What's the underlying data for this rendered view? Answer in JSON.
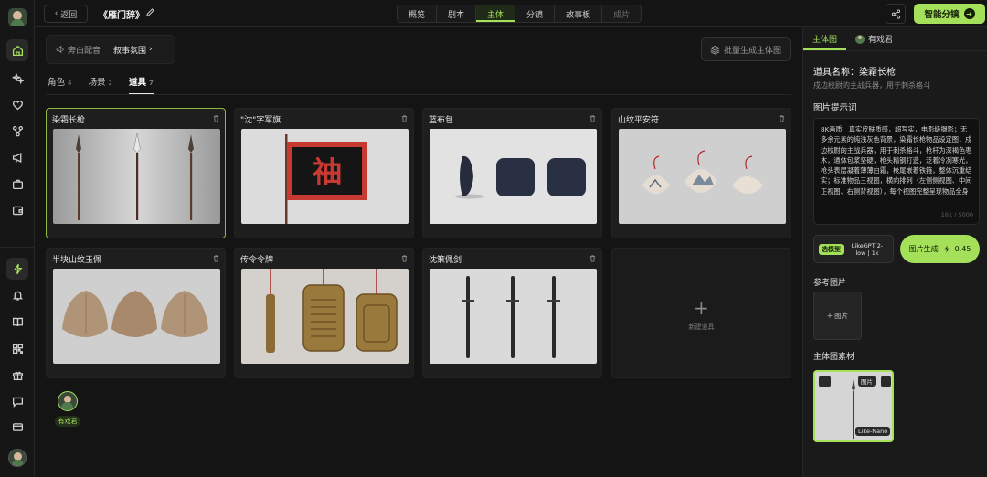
{
  "topbar": {
    "back_label": "返回",
    "doc_title": "《雁门辞》",
    "tabs": [
      {
        "label": "概览",
        "state": "normal"
      },
      {
        "label": "剧本",
        "state": "normal"
      },
      {
        "label": "主体",
        "state": "active"
      },
      {
        "label": "分镜",
        "state": "normal"
      },
      {
        "label": "故事板",
        "state": "normal"
      },
      {
        "label": "成片",
        "state": "disabled"
      }
    ],
    "smart_button": "智能分镜"
  },
  "voice_bar": {
    "narration": "旁白配音",
    "ambience": "叙事氛围"
  },
  "batch_button": "批量生成主体图",
  "subtabs": [
    {
      "label": "角色",
      "count": "4"
    },
    {
      "label": "场景",
      "count": "2"
    },
    {
      "label": "道具",
      "count": "7"
    }
  ],
  "cards": [
    {
      "title": "染霜长枪"
    },
    {
      "title": "\"沈\"字军旗"
    },
    {
      "title": "蓝布包"
    },
    {
      "title": "山纹平安符"
    },
    {
      "title": "半块山纹玉佩"
    },
    {
      "title": "传令令牌"
    },
    {
      "title": "沈策佩剑"
    }
  ],
  "flag_char": "䄂",
  "new_card_label": "新建道具",
  "character": {
    "name": "有戏君"
  },
  "panel": {
    "tabs": [
      {
        "label": "主体图"
      },
      {
        "label": "有戏君"
      }
    ],
    "prop_name": "道具名称：染霜长枪",
    "prop_desc": "戍边校尉的主战兵器，用于刺杀格斗",
    "prompt_title": "图片提示词",
    "prompt_text": "8K画质，真实皮肤质感，超写实，电影级摄影；无多余元素的纯浅灰色背景，染霜长枪物品设定图，戍边校尉的主战兵器，用于刺杀格斗，枪杆为深褐色枣木，通体包浆坚硬，枪头精钢打造，泛着冷冽寒光，枪头表层凝着薄薄白霜，枪尾嵌着铁箍，整体沉重结实；标准物品三视图，横向排列（左侧侧视图、中间正视图、右侧背视图），每个视图完整呈现物品全身",
    "prompt_count": "161 / 5000",
    "model_tag": "选模型",
    "model_name": "LikeGPT 2-low | 1k",
    "gen_label": "图片生成",
    "gen_cost": "0.45",
    "ref_title": "参考图片",
    "ref_add": "图片",
    "asset_title": "主体图素材",
    "asset_tag": "图片",
    "asset_model": "Like-Nano"
  },
  "colors": {
    "accent": "#a4e05a",
    "bg": "#141414",
    "card": "#1e1e1e"
  }
}
